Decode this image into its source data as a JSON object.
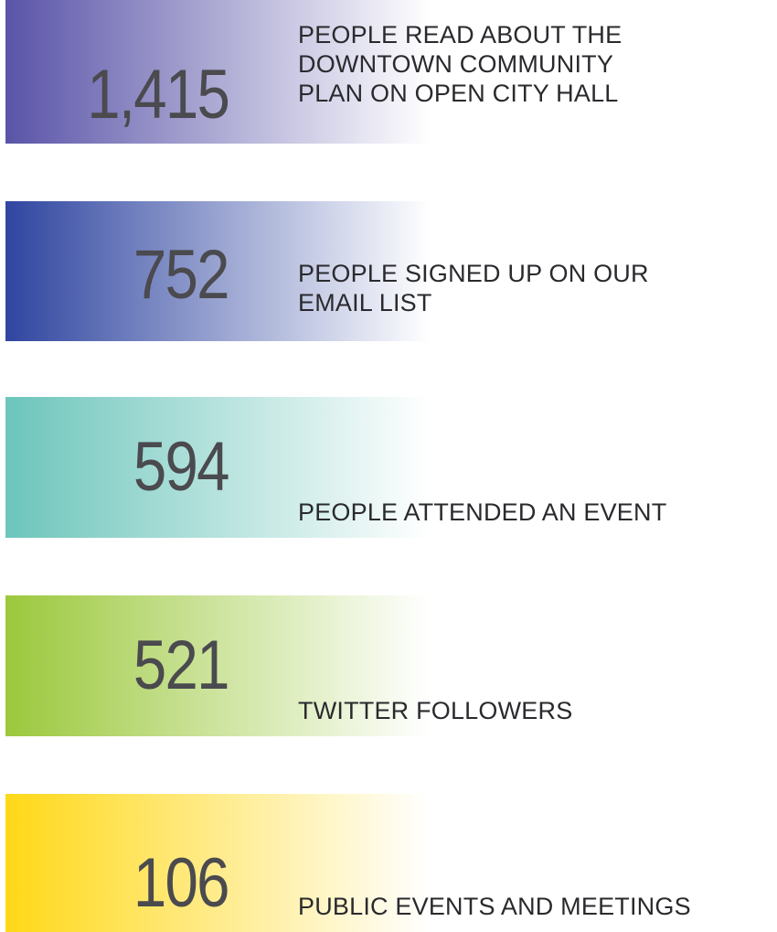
{
  "stats": [
    {
      "number": "1,415",
      "caption_lines": [
        "PEOPLE READ ABOUT THE",
        "DOWNTOWN COMMUNITY",
        "PLAN ON OPEN CITY HALL"
      ],
      "gradient_start": "#5a54a8",
      "gradient_end": "#ffffff"
    },
    {
      "number": "752",
      "caption_lines": [
        "PEOPLE SIGNED UP ON OUR",
        "EMAIL LIST"
      ],
      "gradient_start": "#2f45a0",
      "gradient_end": "#ffffff"
    },
    {
      "number": "594",
      "caption_lines": [
        "PEOPLE ATTENDED AN EVENT"
      ],
      "gradient_start": "#6cc5bb",
      "gradient_end": "#ffffff"
    },
    {
      "number": "521",
      "caption_lines": [
        "TWITTER FOLLOWERS"
      ],
      "gradient_start": "#9bc83c",
      "gradient_end": "#ffffff"
    },
    {
      "number": "106",
      "caption_lines": [
        "PUBLIC EVENTS AND MEETINGS"
      ],
      "gradient_start": "#ffd817",
      "gradient_end": "#ffffff"
    }
  ]
}
